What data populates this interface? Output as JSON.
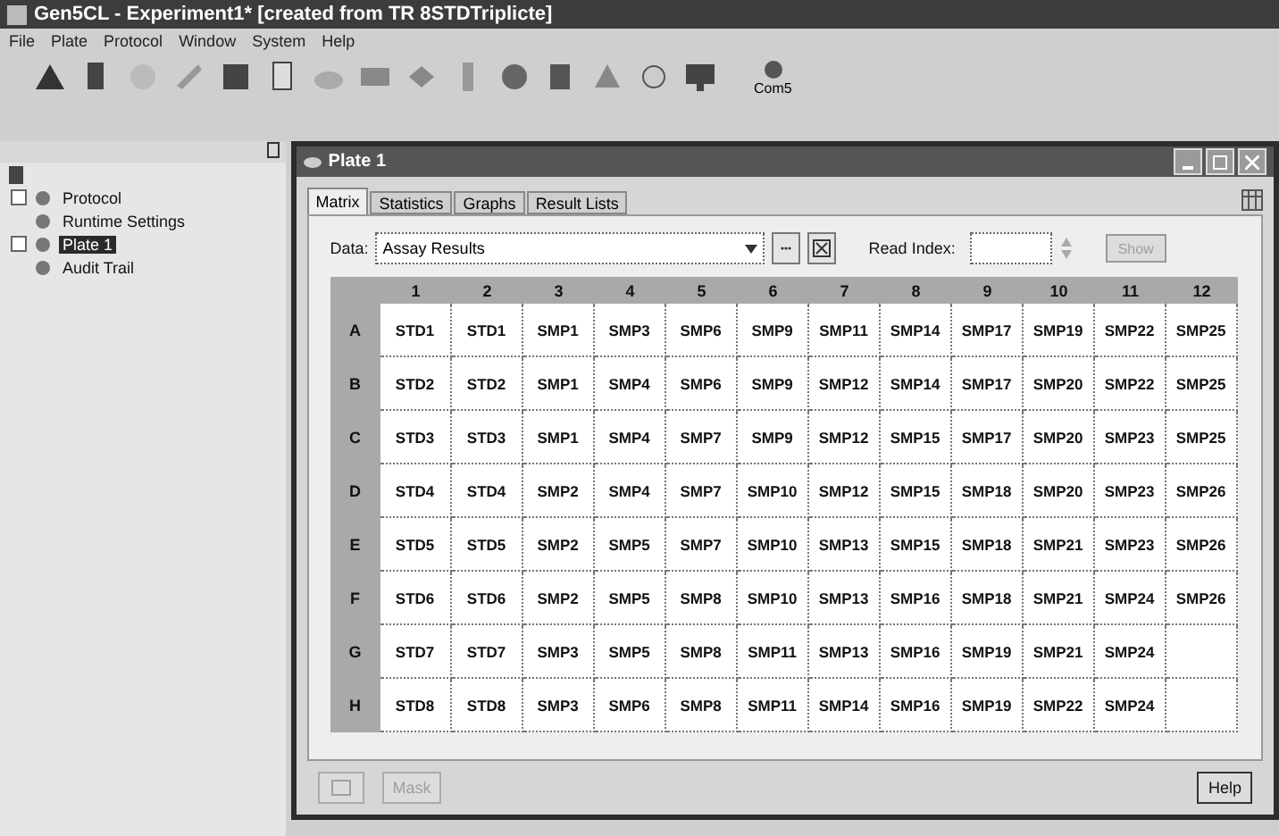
{
  "window": {
    "title": "Gen5CL - Experiment1* [created from TR 8STDTriplicte]"
  },
  "menu": [
    "File",
    "Plate",
    "Protocol",
    "Window",
    "System",
    "Help"
  ],
  "toolbar": {
    "labeled_button": "Com5"
  },
  "tree": {
    "children": [
      {
        "label": "Protocol",
        "expandable": true,
        "selected": false
      },
      {
        "label": "Runtime Settings",
        "expandable": false,
        "selected": false
      },
      {
        "label": "Plate 1",
        "expandable": true,
        "selected": true
      },
      {
        "label": "Audit Trail",
        "expandable": false,
        "selected": false
      }
    ]
  },
  "plate_window": {
    "title": "Plate 1",
    "tabs": [
      {
        "label": "Matrix",
        "selected": true
      },
      {
        "label": "Statistics",
        "selected": false
      },
      {
        "label": "Graphs",
        "selected": false
      },
      {
        "label": "Result Lists",
        "selected": false
      }
    ],
    "data_label": "Data:",
    "data_value": "Assay Results",
    "read_index_label": "Read Index:",
    "show_button": {
      "label": "Show",
      "disabled": true
    },
    "columns": [
      "1",
      "2",
      "3",
      "4",
      "5",
      "6",
      "7",
      "8",
      "9",
      "10",
      "11",
      "12"
    ],
    "rows": [
      {
        "label": "A",
        "cells": [
          "STD1",
          "STD1",
          "SMP1",
          "SMP3",
          "SMP6",
          "SMP9",
          "SMP11",
          "SMP14",
          "SMP17",
          "SMP19",
          "SMP22",
          "SMP25"
        ]
      },
      {
        "label": "B",
        "cells": [
          "STD2",
          "STD2",
          "SMP1",
          "SMP4",
          "SMP6",
          "SMP9",
          "SMP12",
          "SMP14",
          "SMP17",
          "SMP20",
          "SMP22",
          "SMP25"
        ]
      },
      {
        "label": "C",
        "cells": [
          "STD3",
          "STD3",
          "SMP1",
          "SMP4",
          "SMP7",
          "SMP9",
          "SMP12",
          "SMP15",
          "SMP17",
          "SMP20",
          "SMP23",
          "SMP25"
        ]
      },
      {
        "label": "D",
        "cells": [
          "STD4",
          "STD4",
          "SMP2",
          "SMP4",
          "SMP7",
          "SMP10",
          "SMP12",
          "SMP15",
          "SMP18",
          "SMP20",
          "SMP23",
          "SMP26"
        ]
      },
      {
        "label": "E",
        "cells": [
          "STD5",
          "STD5",
          "SMP2",
          "SMP5",
          "SMP7",
          "SMP10",
          "SMP13",
          "SMP15",
          "SMP18",
          "SMP21",
          "SMP23",
          "SMP26"
        ]
      },
      {
        "label": "F",
        "cells": [
          "STD6",
          "STD6",
          "SMP2",
          "SMP5",
          "SMP8",
          "SMP10",
          "SMP13",
          "SMP16",
          "SMP18",
          "SMP21",
          "SMP24",
          "SMP26"
        ]
      },
      {
        "label": "G",
        "cells": [
          "STD7",
          "STD7",
          "SMP3",
          "SMP5",
          "SMP8",
          "SMP11",
          "SMP13",
          "SMP16",
          "SMP19",
          "SMP21",
          "SMP24",
          null
        ]
      },
      {
        "label": "H",
        "cells": [
          "STD8",
          "STD8",
          "SMP3",
          "SMP6",
          "SMP8",
          "SMP11",
          "SMP14",
          "SMP16",
          "SMP19",
          "SMP22",
          "SMP24",
          null
        ]
      }
    ],
    "bottom_buttons": [
      {
        "kind": "icon",
        "disabled": true
      },
      {
        "kind": "text",
        "label": "Mask",
        "disabled": true
      },
      {
        "kind": "text",
        "label": "Help",
        "disabled": false
      }
    ]
  }
}
